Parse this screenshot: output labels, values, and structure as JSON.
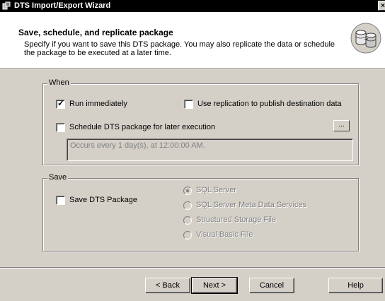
{
  "window": {
    "title": "DTS Import/Export Wizard",
    "close_label": "×"
  },
  "header": {
    "title": "Save, schedule, and replicate package",
    "description": "Specify if you want to save this DTS package.  You may also replicate the data or schedule the package to be executed at a later time."
  },
  "when": {
    "legend": "When",
    "run_immediately": {
      "label": "Run immediately",
      "checked": true
    },
    "use_replication": {
      "label": "Use replication to publish destination data",
      "checked": false
    },
    "schedule": {
      "label": "Schedule DTS package for later execution",
      "checked": false
    },
    "ellipsis_label": "...",
    "schedule_text": "Occurs every 1 day(s), at 12:00:00 AM."
  },
  "save": {
    "legend": "Save",
    "save_package": {
      "label": "Save DTS Package",
      "checked": false
    },
    "options": [
      {
        "label": "SQL Server",
        "selected": true
      },
      {
        "label": "SQL Server Meta Data Services",
        "selected": false
      },
      {
        "label": "Structured Storage File",
        "selected": false
      },
      {
        "label": "Visual Basic File",
        "selected": false
      }
    ]
  },
  "buttons": {
    "back": "< Back",
    "next": "Next >",
    "cancel": "Cancel",
    "help": "Help"
  },
  "colors": {
    "dialog_bg": "#d4d0c8",
    "titlebar_bg": "#000000",
    "disabled_text": "#808080"
  }
}
